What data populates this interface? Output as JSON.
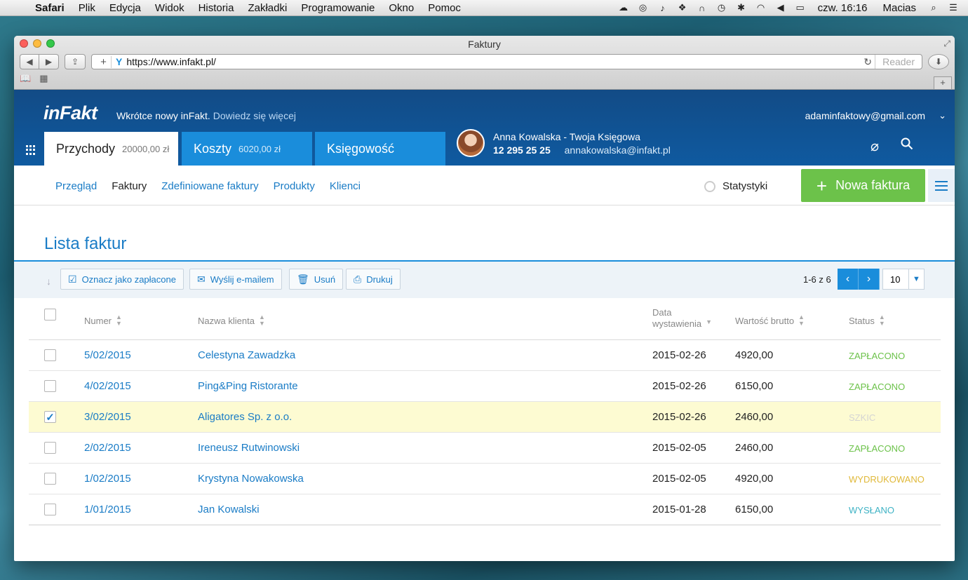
{
  "menubar": {
    "app": "Safari",
    "items": [
      "Plik",
      "Edycja",
      "Widok",
      "Historia",
      "Zakładki",
      "Programowanie",
      "Okno",
      "Pomoc"
    ],
    "clock": "czw. 16:16",
    "user": "Macias"
  },
  "browser": {
    "title": "Faktury",
    "url": "https://www.infakt.pl/",
    "reader": "Reader"
  },
  "header": {
    "logo": "inFakt",
    "announce_text": "Wkrótce nowy inFakt.",
    "announce_link": "Dowiedz się więcej",
    "account_email": "adaminfaktowy@gmail.com",
    "tabs": [
      {
        "label": "Przychody",
        "amount": "20000,00 zł"
      },
      {
        "label": "Koszty",
        "amount": "6020,00 zł"
      },
      {
        "label": "Księgowość",
        "amount": ""
      }
    ],
    "accountant": {
      "name": "Anna Kowalska - Twoja Księgowa",
      "phone": "12 295 25 25",
      "email": "annakowalska@infakt.pl"
    }
  },
  "subnav": {
    "links": [
      "Przegląd",
      "Faktury",
      "Zdefiniowane faktury",
      "Produkty",
      "Klienci"
    ],
    "active": "Faktury",
    "stats_label": "Statystyki",
    "new_invoice_label": "Nowa faktura"
  },
  "page": {
    "title": "Lista faktur"
  },
  "actions": {
    "mark_paid": "Oznacz jako zapłacone",
    "send_email": "Wyślij e-mailem",
    "delete": "Usuń",
    "print": "Drukuj",
    "pager_info": "1-6 z 6",
    "per_page": "10"
  },
  "table": {
    "headers": {
      "number": "Numer",
      "client": "Nazwa klienta",
      "date_line1": "Data",
      "date_line2": "wystawienia",
      "amount": "Wartość brutto",
      "status": "Status"
    },
    "rows": [
      {
        "number": "5/02/2015",
        "client": "Celestyna Zawadzka",
        "date": "2015-02-26",
        "amount": "4920,00",
        "status": "ZAPŁACONO",
        "status_kind": "paid",
        "checked": false
      },
      {
        "number": "4/02/2015",
        "client": "Ping&Ping Ristorante",
        "date": "2015-02-26",
        "amount": "6150,00",
        "status": "ZAPŁACONO",
        "status_kind": "paid",
        "checked": false
      },
      {
        "number": "3/02/2015",
        "client": "Aligatores Sp. z o.o.",
        "date": "2015-02-26",
        "amount": "2460,00",
        "status": "SZKIC",
        "status_kind": "draft",
        "checked": true
      },
      {
        "number": "2/02/2015",
        "client": "Ireneusz Rutwinowski",
        "date": "2015-02-05",
        "amount": "2460,00",
        "status": "ZAPŁACONO",
        "status_kind": "paid",
        "checked": false
      },
      {
        "number": "1/02/2015",
        "client": "Krystyna Nowakowska",
        "date": "2015-02-05",
        "amount": "4920,00",
        "status": "WYDRUKOWANO",
        "status_kind": "printed",
        "checked": false
      },
      {
        "number": "1/01/2015",
        "client": "Jan Kowalski",
        "date": "2015-01-28",
        "amount": "6150,00",
        "status": "WYSŁANO",
        "status_kind": "sent",
        "checked": false
      }
    ]
  },
  "colors": {
    "brand_blue": "#1a7cc6",
    "header_blue": "#124b86",
    "green": "#6cc24a",
    "selected_row": "#fdfbd2"
  }
}
